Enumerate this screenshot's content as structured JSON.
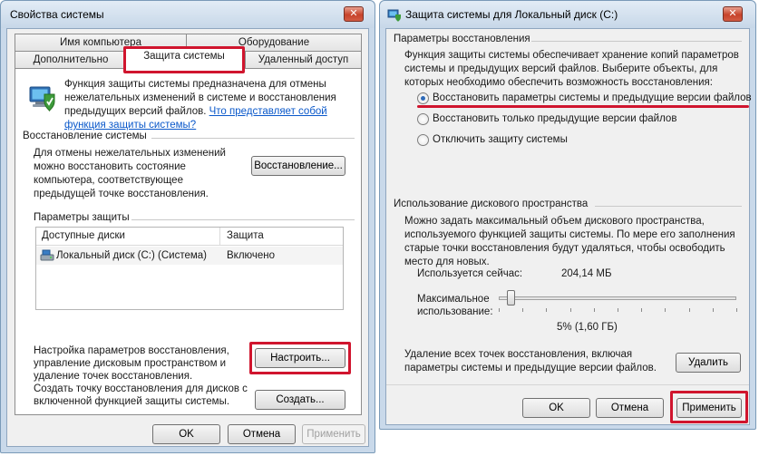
{
  "left_window": {
    "title": "Свойства системы",
    "close_glyph": "✕",
    "tabs_row1": [
      "Имя компьютера",
      "Оборудование"
    ],
    "tabs_row2": [
      "Дополнительно",
      "Защита системы",
      "Удаленный доступ"
    ],
    "intro_text": "Функция защиты системы предназначена для отмены нежелательных изменений в системе и восстановления предыдущих версий файлов.",
    "intro_link1": "Что представляет собой",
    "intro_link2": "функция защиты системы?",
    "restore_group_title": "Восстановление системы",
    "restore_text": "Для отмены нежелательных изменений можно восстановить состояние компьютера, соответствующее предыдущей точке восстановления.",
    "restore_button": "Восстановление...",
    "protection_group_title": "Параметры защиты",
    "table_headers": [
      "Доступные диски",
      "Защита"
    ],
    "table_rows": [
      {
        "disk": "Локальный диск (C:) (Система)",
        "protection": "Включено"
      }
    ],
    "configure_text": "Настройка параметров восстановления, управление дисковым пространством и удаление точек восстановления.",
    "configure_button": "Настроить...",
    "create_text": "Создать точку восстановления для дисков с включенной функцией защиты системы.",
    "create_button": "Создать...",
    "ok_button": "OK",
    "cancel_button": "Отмена",
    "apply_button": "Применить"
  },
  "right_window": {
    "title": "Защита системы для Локальный диск (C:)",
    "close_glyph": "✕",
    "restore_group_title": "Параметры восстановления",
    "restore_text": "Функция защиты системы обеспечивает хранение копий параметров системы и предыдущих версий файлов. Выберите объекты, для которых необходимо обеспечить возможность восстановления:",
    "options": [
      "Восстановить параметры системы и предыдущие версии файлов",
      "Восстановить только предыдущие версии файлов",
      "Отключить защиту системы"
    ],
    "selected_option": 0,
    "disk_group_title": "Использование дискового пространства",
    "disk_text": "Можно задать максимальный объем дискового пространства, используемого функцией защиты системы. По мере его заполнения старые точки восстановления будут удаляться, чтобы освободить место для новых.",
    "used_label": "Используется сейчас:",
    "used_value": "204,14 МБ",
    "max_label_line1": "Максимальное",
    "max_label_line2": "использование:",
    "slider_percent": 5,
    "slider_value_text": "5% (1,60 ГБ)",
    "delete_text": "Удаление всех точек восстановления, включая параметры системы и предыдущие версии файлов.",
    "delete_button": "Удалить",
    "ok_button": "OK",
    "cancel_button": "Отмена",
    "apply_button": "Применить"
  },
  "colors": {
    "highlight_red": "#d0152e",
    "link_blue": "#0a58ca",
    "radio_blue": "#2e6ab8"
  }
}
